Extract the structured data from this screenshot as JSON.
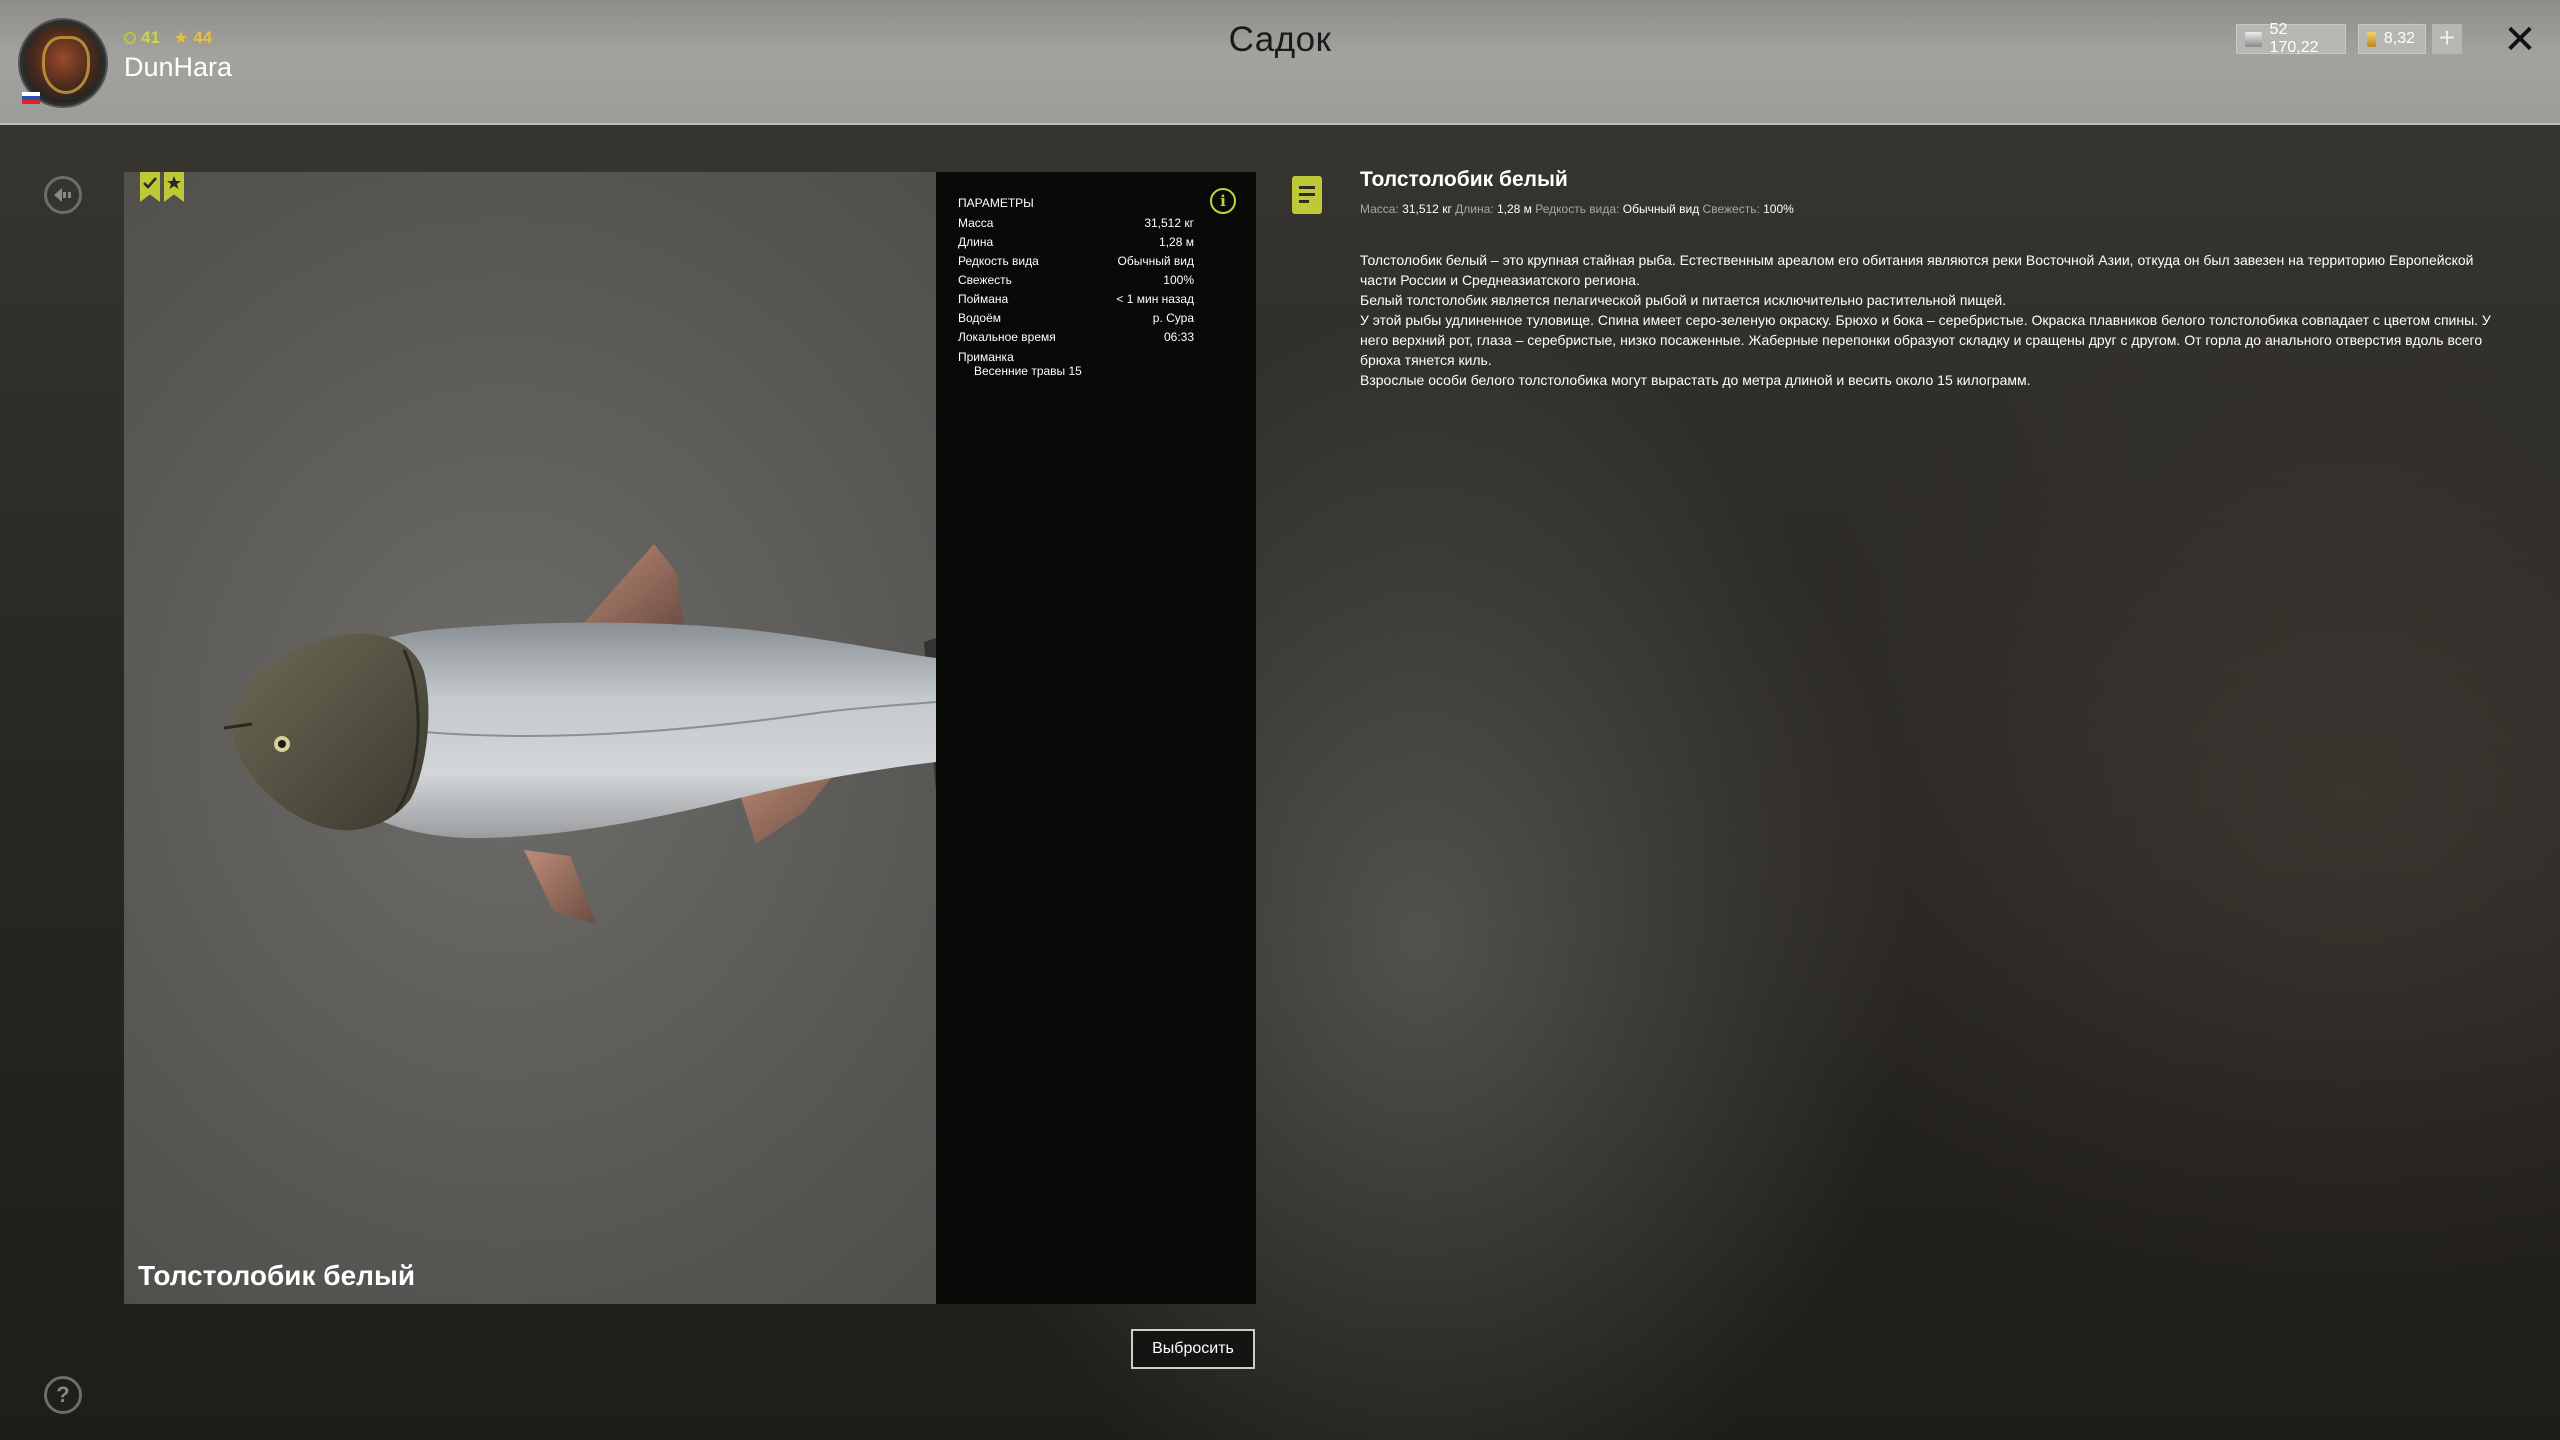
{
  "header": {
    "title": "Садок",
    "username": "DunHara",
    "level": "41",
    "rank": "44",
    "silver": "52 170,22",
    "gold": "8,32",
    "plus_label": "+",
    "close_label": "✕"
  },
  "fish": {
    "name": "Толстолобик белый",
    "params_title": "ПАРАМЕТРЫ",
    "params": [
      {
        "label": "Масса",
        "value": "31,512 кг"
      },
      {
        "label": "Длина",
        "value": "1,28 м"
      },
      {
        "label": "Редкость вида",
        "value": "Обычный вид"
      },
      {
        "label": "Свежесть",
        "value": "100%"
      },
      {
        "label": "Поймана",
        "value": "< 1 мин назад"
      },
      {
        "label": "Водоём",
        "value": "р. Сура"
      },
      {
        "label": "Локальное время",
        "value": "06:33"
      }
    ],
    "lure_label": "Приманка",
    "lure_value": "Весенние травы 15",
    "discard_label": "Выбросить"
  },
  "description": {
    "title": "Толстолобик белый",
    "meta": {
      "mass_label": "Масса:",
      "mass_value": "31,512 кг",
      "length_label": "Длина:",
      "length_value": "1,28 м",
      "rarity_label": "Редкость вида:",
      "rarity_value": "Обычный вид",
      "fresh_label": "Свежесть:",
      "fresh_value": "100%"
    },
    "paragraphs": [
      "Толстолобик белый – это крупная стайная рыба. Естественным ареалом его обитания являются реки Восточной Азии, откуда он был завезен на территорию Европейской части России и Среднеазиатского региона.",
      "Белый толстолобик является пелагической рыбой и питается исключительно растительной пищей.",
      "У этой рыбы удлиненное туловище. Спина имеет серо-зеленую окраску. Брюхо и бока – серебристые. Окраска плавников белого толстолобика совпадает с цветом спины. У него верхний рот, глаза – серебристые, низко посаженные. Жаберные перепонки образуют складку и сращены друг с другом. От горла до анального отверстия вдоль всего брюха тянется киль.",
      "Взрослые особи белого толстолобика могут вырастать до метра длиной и весить около 15 килограмм."
    ]
  },
  "icons": {
    "back": "back-arrow-icon",
    "help": "help-icon",
    "info": "info-icon",
    "description": "document-icon",
    "bookmarks": [
      "bookmark-check-icon",
      "bookmark-star-icon"
    ]
  },
  "colors": {
    "accent": "#bfc836",
    "topbar": "#9e9d99"
  }
}
